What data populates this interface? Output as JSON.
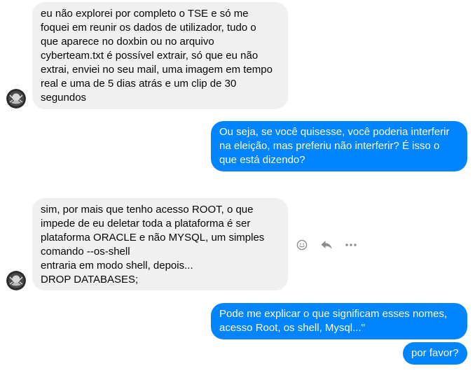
{
  "messages": [
    {
      "direction": "incoming",
      "text": "eu não explorei por completo o TSE e só me\nfoquei em reunir os dados de utilizador, tudo o\nque aparece no doxbin ou no arquivo\ncyberteam.txt é possível extrair, só que eu não\nextrai, enviei no seu mail, uma imagem em tempo\nreal e uma de 5 dias atrás e um clip de 30\nsegundos"
    },
    {
      "direction": "outgoing",
      "text": "Ou seja, se você quisesse, você poderia interferir\nna eleição, mas preferiu não interferir? É isso o\nque está dizendo?"
    },
    {
      "direction": "incoming",
      "text": "sim, por mais que tenho acesso ROOT, o que\nimpede de eu deletar toda a plataforma é ser\nplataforma ORACLE e não MYSQL, um simples\ncomando --os-shell\nentraria em modo shell, depois...\nDROP DATABASES;"
    },
    {
      "direction": "outgoing",
      "text": "Pode me explicar o que significam esses nomes,\nacesso Root, os shell,  Mysql...\""
    },
    {
      "direction": "outgoing",
      "text": "por favor?"
    }
  ],
  "message_actions": {
    "icons": [
      "smiley-icon",
      "reply-icon",
      "more-icon"
    ]
  },
  "colors": {
    "outgoing_bubble": "#0084ff",
    "incoming_bubble": "#f0f0f0",
    "action_icon": "#8a8d91"
  }
}
